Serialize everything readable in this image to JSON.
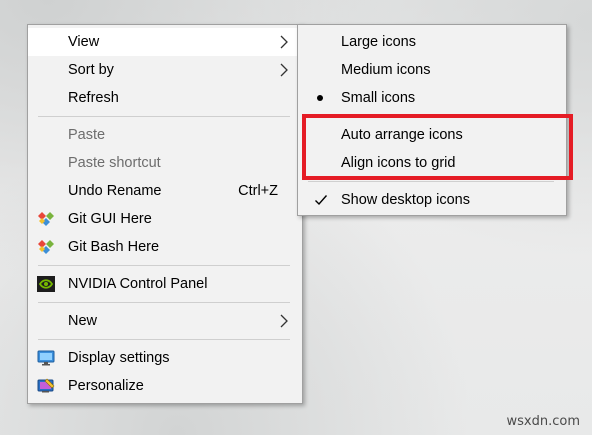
{
  "main_menu": {
    "items": [
      {
        "label": "View",
        "submenu": true,
        "hover": true,
        "icon": "none"
      },
      {
        "label": "Sort by",
        "submenu": true,
        "icon": "none"
      },
      {
        "label": "Refresh",
        "icon": "none"
      },
      {
        "label": "Paste",
        "disabled": true,
        "icon": "none"
      },
      {
        "label": "Paste shortcut",
        "disabled": true,
        "icon": "none"
      },
      {
        "label": "Undo Rename",
        "shortcut": "Ctrl+Z",
        "icon": "none"
      },
      {
        "label": "Git GUI Here",
        "icon": "git-diamond-icon"
      },
      {
        "label": "Git Bash Here",
        "icon": "git-diamond-icon"
      },
      {
        "label": "NVIDIA Control Panel",
        "icon": "nvidia-icon"
      },
      {
        "label": "New",
        "submenu": true,
        "icon": "none"
      },
      {
        "label": "Display settings",
        "icon": "display-icon"
      },
      {
        "label": "Personalize",
        "icon": "personalize-icon"
      }
    ]
  },
  "view_submenu": {
    "items": [
      {
        "label": "Large icons",
        "mark": "none"
      },
      {
        "label": "Medium icons",
        "mark": "none"
      },
      {
        "label": "Small icons",
        "mark": "bullet"
      },
      {
        "label": "Auto arrange icons",
        "mark": "none"
      },
      {
        "label": "Align icons to grid",
        "mark": "none"
      },
      {
        "label": "Show desktop icons",
        "mark": "check"
      }
    ]
  },
  "highlight_color": "#e51c25",
  "watermark": "wsxdn.com"
}
